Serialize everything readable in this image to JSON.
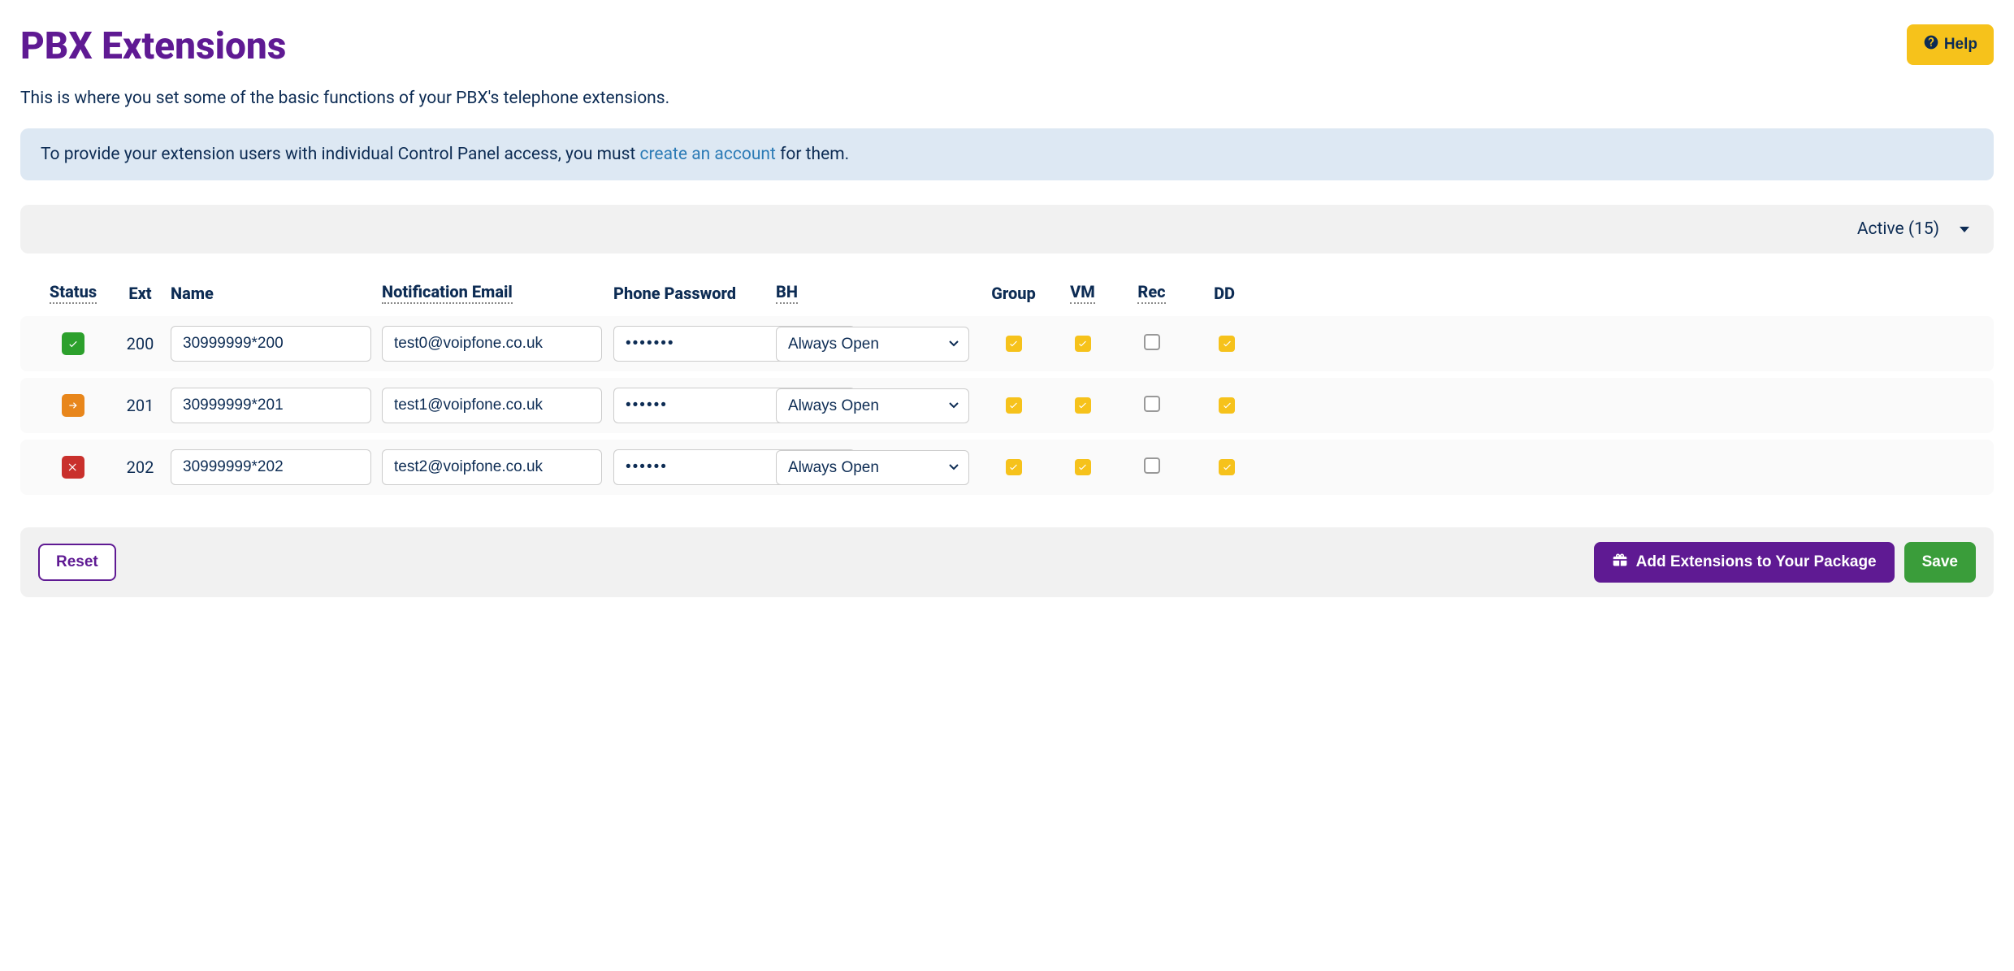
{
  "header": {
    "title": "PBX Extensions",
    "help_label": "Help"
  },
  "intro": "This is where you set some of the basic functions of your PBX's telephone extensions.",
  "banner": {
    "before": "To provide your extension users with individual Control Panel access, you must ",
    "link": "create an account",
    "after": " for them."
  },
  "filter": {
    "label": "Active (15)"
  },
  "columns": {
    "status": "Status",
    "ext": "Ext",
    "name": "Name",
    "email": "Notification Email",
    "password": "Phone Password",
    "bh": "BH",
    "group": "Group",
    "vm": "VM",
    "rec": "Rec",
    "dd": "DD"
  },
  "bh_option": "Always Open",
  "rows": [
    {
      "status": "green",
      "status_icon": "check",
      "ext": "200",
      "name": "30999999*200",
      "email": "test0@voipfone.co.uk",
      "password": "•••••••",
      "bh": "Always Open",
      "group": true,
      "vm": true,
      "rec": false,
      "dd": true
    },
    {
      "status": "orange",
      "status_icon": "arrow",
      "ext": "201",
      "name": "30999999*201",
      "email": "test1@voipfone.co.uk",
      "password": "••••••",
      "bh": "Always Open",
      "group": true,
      "vm": true,
      "rec": false,
      "dd": true
    },
    {
      "status": "red",
      "status_icon": "cross",
      "ext": "202",
      "name": "30999999*202",
      "email": "test2@voipfone.co.uk",
      "password": "••••••",
      "bh": "Always Open",
      "group": true,
      "vm": true,
      "rec": false,
      "dd": true
    }
  ],
  "footer": {
    "reset": "Reset",
    "add": "Add Extensions to Your Package",
    "save": "Save"
  }
}
